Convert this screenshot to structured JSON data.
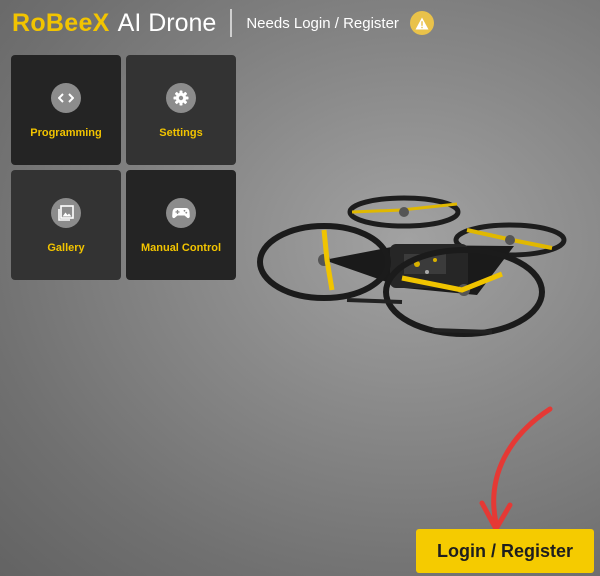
{
  "header": {
    "brand": "RoBeeX",
    "product": "AI Drone",
    "status": "Needs Login / Register",
    "warning_icon": "warning-icon"
  },
  "tiles": [
    {
      "label": "Programming",
      "icon": "code-icon"
    },
    {
      "label": "Settings",
      "icon": "gear-icon"
    },
    {
      "label": "Gallery",
      "icon": "image-icon"
    },
    {
      "label": "Manual Control",
      "icon": "gamepad-icon"
    }
  ],
  "login_button": {
    "label": "Login / Register"
  },
  "colors": {
    "accent": "#f2c400",
    "button": "#f5cb00",
    "annotation": "#e53935"
  }
}
